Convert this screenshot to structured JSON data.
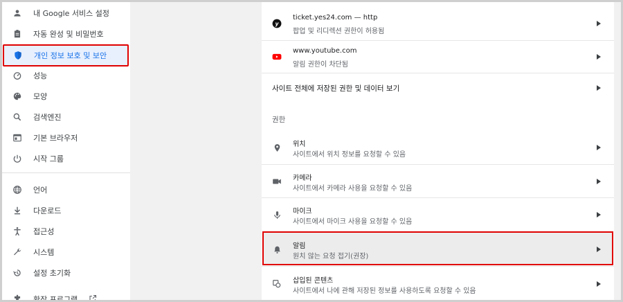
{
  "sidebar": {
    "items": [
      {
        "label": "내 Google 서비스 설정",
        "icon": "person-icon"
      },
      {
        "label": "자동 완성 및 비밀번호",
        "icon": "clipboard-icon"
      },
      {
        "label": "개인 정보 보호 및 보안",
        "icon": "shield-icon",
        "active": true
      },
      {
        "label": "성능",
        "icon": "speedometer-icon"
      },
      {
        "label": "모양",
        "icon": "palette-icon"
      },
      {
        "label": "검색엔진",
        "icon": "search-icon"
      },
      {
        "label": "기본 브라우저",
        "icon": "browser-icon"
      },
      {
        "label": "시작 그룹",
        "icon": "power-icon"
      },
      {
        "label": "언어",
        "icon": "globe-icon"
      },
      {
        "label": "다운로드",
        "icon": "download-icon"
      },
      {
        "label": "접근성",
        "icon": "accessibility-icon"
      },
      {
        "label": "시스템",
        "icon": "wrench-icon"
      },
      {
        "label": "설정 초기화",
        "icon": "history-icon"
      },
      {
        "label": "확장 프로그램",
        "icon": "puzzle-icon"
      }
    ]
  },
  "main": {
    "sites": [
      {
        "title": "ticket.yes24.com — http",
        "subtitle": "팝업 및 리디렉션 권한이 허용됨",
        "icon": "yes24-favicon-icon"
      },
      {
        "title": "www.youtube.com",
        "subtitle": "알림 권한이 차단됨",
        "icon": "youtube-favicon-icon"
      }
    ],
    "all_sites_label": "사이트 전체에 저장된 권한 및 데이터 보기",
    "permissions_header": "권한",
    "permissions": [
      {
        "title": "위치",
        "subtitle": "사이트에서 위치 정보를 요청할 수 있음",
        "icon": "location-icon"
      },
      {
        "title": "카메라",
        "subtitle": "사이트에서 카메라 사용을 요청할 수 있음",
        "icon": "camera-icon"
      },
      {
        "title": "마이크",
        "subtitle": "사이트에서 마이크 사용을 요청할 수 있음",
        "icon": "microphone-icon"
      },
      {
        "title": "알림",
        "subtitle": "원치 않는 요청 접기(권장)",
        "icon": "bell-icon"
      },
      {
        "title": "삽입된 콘텐츠",
        "subtitle": "사이트에서 나에 관해 저장된 정보를 사용하도록 요청할 수 있음",
        "icon": "embedded-content-icon"
      }
    ]
  },
  "colors": {
    "accent": "#1a73e8",
    "highlight": "#e00000",
    "active_bg": "#e8f0fe"
  }
}
